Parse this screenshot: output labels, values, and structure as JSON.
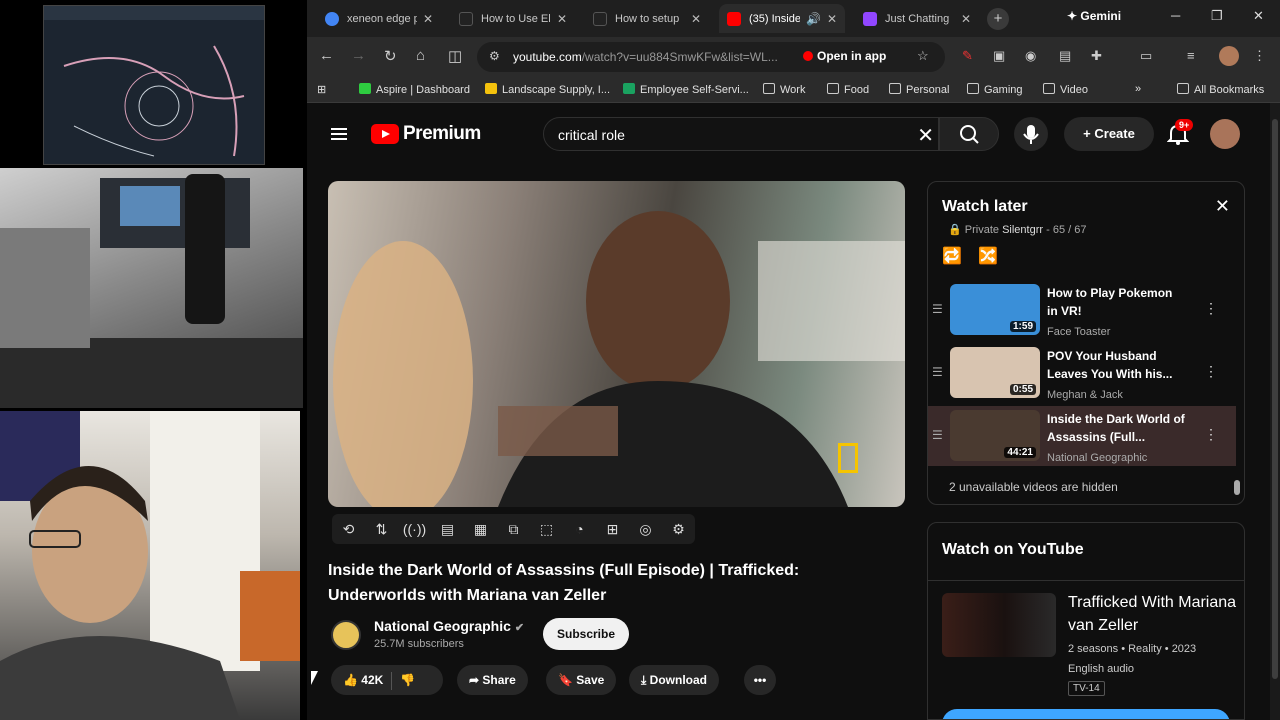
{
  "browser": {
    "tabs": [
      {
        "title": "xeneon edge p",
        "favicon_color": "#4285f4",
        "active": false
      },
      {
        "title": "How to Use El",
        "favicon_color": "#222222",
        "active": false
      },
      {
        "title": "How to setup",
        "favicon_color": "#222222",
        "active": false
      },
      {
        "title": "(35) Inside",
        "favicon_color": "#ff0000",
        "active": true
      },
      {
        "title": "Just Chatting",
        "favicon_color": "#9146ff",
        "active": false
      }
    ],
    "gemini_label": "Gemini",
    "url_main": "youtube.com",
    "url_rest": "/watch?v=uu884SmwKFw&list=WL...",
    "open_in_app": "Open in app",
    "bookmarks": [
      {
        "label": "Aspire | Dashboard",
        "icon": "aspire-icon",
        "color": "#2ecc40"
      },
      {
        "label": "Landscape Supply, I...",
        "icon": "landscape-icon",
        "color": "#f4c20d"
      },
      {
        "label": "Employee Self-Servi...",
        "icon": "employee-icon",
        "color": "#1aa260"
      },
      {
        "label": "Work",
        "icon": "folder-icon",
        "color": ""
      },
      {
        "label": "Food",
        "icon": "folder-icon",
        "color": ""
      },
      {
        "label": "Personal",
        "icon": "folder-icon",
        "color": ""
      },
      {
        "label": "Gaming",
        "icon": "folder-icon",
        "color": ""
      },
      {
        "label": "Video",
        "icon": "folder-icon",
        "color": ""
      }
    ],
    "all_bookmarks": "All Bookmarks"
  },
  "youtube": {
    "logo_text": "Premium",
    "search_query": "critical role",
    "create_label": "Create",
    "notif_badge": "9+",
    "video": {
      "title": "Inside the Dark World of Assassins (Full Episode) | Trafficked: Underworlds with Mariana van Zeller",
      "channel": "National Geographic",
      "subscribers": "25.7M subscribers",
      "subscribe_label": "Subscribe",
      "likes": "42K",
      "share_label": "Share",
      "save_label": "Save",
      "download_label": "Download"
    },
    "playlist": {
      "title": "Watch later",
      "owner": "Silentgrr",
      "privacy": "Private",
      "position": "65 / 67",
      "items": [
        {
          "title": "How to Play Pokemon in VR!",
          "channel": "Face Toaster",
          "duration": "1:59",
          "thumb": "#3a8fd8"
        },
        {
          "title": "POV Your Husband Leaves You With his...",
          "channel": "Meghan & Jack",
          "duration": "0:55",
          "thumb": "#d8c4b0"
        },
        {
          "title": "Inside the Dark World of Assassins (Full...",
          "channel": "National Geographic",
          "duration": "44:21",
          "thumb": "#4a3a30"
        }
      ],
      "hidden_note": "2 unavailable videos are hidden"
    },
    "watch_on": {
      "heading": "Watch on YouTube",
      "show_title": "Trafficked With Mariana van Zeller",
      "info": "2 seasons • Reality • 2023",
      "language": "English audio",
      "rating": "TV-14"
    }
  },
  "colors": {
    "accent": "#ff0000",
    "link_blue": "#3ea6ff",
    "gold": "#f5c400"
  }
}
